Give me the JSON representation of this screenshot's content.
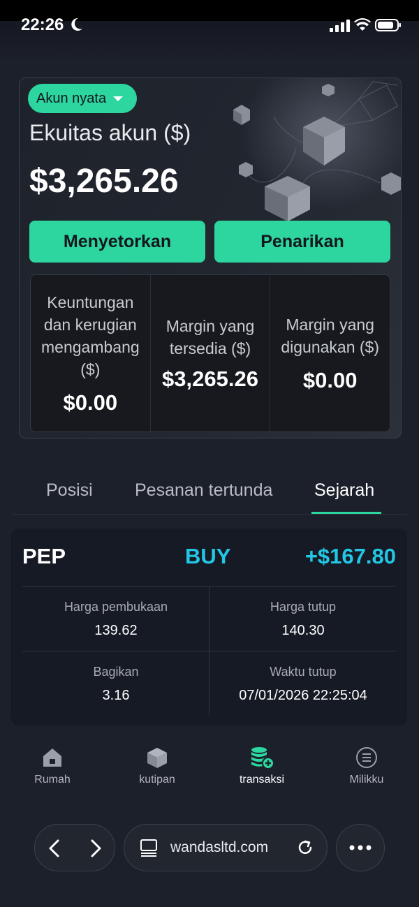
{
  "status": {
    "time": "22:26"
  },
  "account": {
    "type_badge": "Akun nyata",
    "equity_label": "Ekuitas akun ($)",
    "equity_value": "$3,265.26",
    "deposit_label": "Menyetorkan",
    "withdraw_label": "Penarikan",
    "stats": [
      {
        "label": "Keuntungan dan kerugian mengambang ($)",
        "value": "$0.00"
      },
      {
        "label": "Margin yang tersedia ($)",
        "value": "$3,265.26"
      },
      {
        "label": "Margin yang digunakan ($)",
        "value": "$0.00"
      }
    ]
  },
  "tabs": [
    "Posisi",
    "Pesanan tertunda",
    "Sejarah"
  ],
  "active_tab": "Sejarah",
  "trade": {
    "symbol": "PEP",
    "side": "BUY",
    "pnl": "+$167.80",
    "open_price_label": "Harga pembukaan",
    "open_price": "139.62",
    "close_price_label": "Harga tutup",
    "close_price": "140.30",
    "shares_label": "Bagikan",
    "shares": "3.16",
    "close_time_label": "Waktu tutup",
    "close_time": "07/01/2026 22:25:04"
  },
  "bottom_nav": [
    {
      "label": "Rumah",
      "icon": "home-icon"
    },
    {
      "label": "kutipan",
      "icon": "cube-icon"
    },
    {
      "label": "transaksi",
      "icon": "coins-icon"
    },
    {
      "label": "Milikku",
      "icon": "menu-icon"
    }
  ],
  "browser": {
    "url": "wandasltd.com"
  },
  "colors": {
    "accent": "#2dd59f",
    "buy": "#22c7e6",
    "background": "#1c202b"
  }
}
